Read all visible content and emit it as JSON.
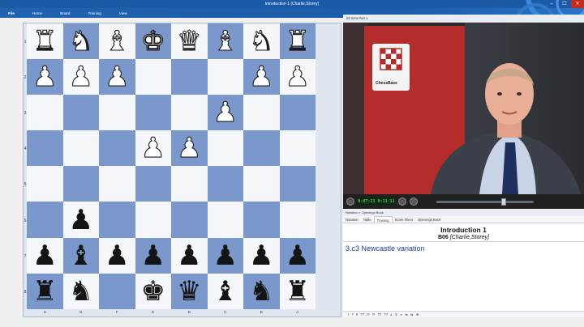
{
  "window": {
    "title": "Introduction 1  (Charlie,Storey)",
    "controls": [
      "–",
      "☐",
      "✕"
    ]
  },
  "menu": [
    "File",
    "Home",
    "Board",
    "Training",
    "View"
  ],
  "board": {
    "ranks": [
      "1",
      "2",
      "3",
      "4",
      "5",
      "6",
      "7",
      "8"
    ],
    "files": [
      "H",
      "G",
      "F",
      "E",
      "D",
      "C",
      "B",
      "A"
    ],
    "position": [
      [
        "wR",
        "wN",
        "wB",
        "wK",
        "wQ",
        "wB",
        "wN",
        "wR"
      ],
      [
        "wP",
        "wP",
        "wP",
        "",
        "",
        "",
        "wP",
        "wP"
      ],
      [
        "",
        "",
        "",
        "",
        "",
        "wP",
        "",
        ""
      ],
      [
        "",
        "",
        "",
        "wP",
        "wP",
        "",
        "",
        ""
      ],
      [
        "",
        "",
        "",
        "",
        "",
        "",
        "",
        ""
      ],
      [
        "",
        "bP",
        "",
        "",
        "",
        "",
        "",
        ""
      ],
      [
        "bP",
        "bB",
        "bP",
        "bP",
        "bP",
        "bP",
        "bP",
        "bP"
      ],
      [
        "bR",
        "bN",
        "",
        "bK",
        "bQ",
        "bB",
        "bN",
        "bR"
      ]
    ]
  },
  "video": {
    "tab": "02 Intro Part 1",
    "logo_text": "ChessBase",
    "timer": "0:07:21  0:11:11"
  },
  "notation": {
    "panel_title": "Notation × Openings Book",
    "tabs": [
      "Notation",
      "Table",
      "Training",
      "Score sheet",
      "Openings Book"
    ],
    "active_tab": "Training",
    "game_title": "Introduction 1",
    "eco": "B06",
    "players": "[Charlie,Storey]",
    "move": "3.c3 Newcastle variation",
    "annotation_symbols": "! ? !! ?? !? ?! ?? ?? ± ∓ ∞ ⇆ ⇆ ⊕"
  },
  "colors": {
    "light": "#f6f7fb",
    "dark": "#7b98cc",
    "ribbon": "#1c5ca8"
  }
}
